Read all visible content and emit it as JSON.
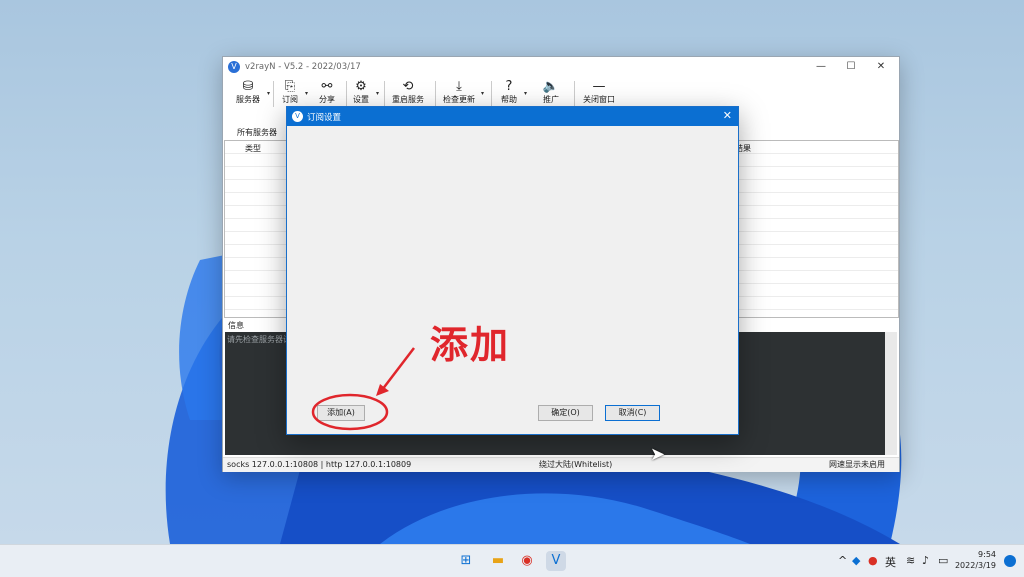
{
  "main_window": {
    "title": "v2rayN - V5.2 - 2022/03/17",
    "controls": {
      "minimize": "—",
      "maximize": "☐",
      "close": "✕"
    },
    "toolbar": [
      {
        "label": "服务器",
        "icon": "database-icon",
        "glyph": "⛁"
      },
      {
        "label": "订阅",
        "icon": "subscribe-icon",
        "glyph": "⎘"
      },
      {
        "label": "分享",
        "icon": "share-icon",
        "glyph": "⚯"
      },
      {
        "label": "设置",
        "icon": "gear-icon",
        "glyph": "⚙"
      },
      {
        "label": "重启服务",
        "icon": "restart-icon",
        "glyph": "⟲"
      },
      {
        "label": "检查更新",
        "icon": "download-icon",
        "glyph": "⤓"
      },
      {
        "label": "帮助",
        "icon": "help-icon",
        "glyph": "?"
      },
      {
        "label": "推广",
        "icon": "speaker-icon",
        "glyph": "🔈"
      },
      {
        "label": "关闭窗口",
        "icon": "minimize-window-icon",
        "glyph": "—"
      }
    ],
    "tab_all_servers": "所有服务器",
    "column_type": "类型",
    "column_result": "结果",
    "info_label": "信息",
    "log_text": "请先检查服务器设",
    "status": {
      "left": "socks 127.0.0.1:10808 | http 127.0.0.1:10809",
      "middle": "绕过大陆(Whitelist)",
      "right": "网速显示未启用"
    }
  },
  "dialog": {
    "title": "订阅设置",
    "close": "✕",
    "add_button": "添加(A)",
    "ok_button": "确定(O)",
    "cancel_button": "取消(C)"
  },
  "annotation": {
    "text": "添加",
    "color": "#e0262c"
  },
  "taskbar": {
    "tray": {
      "chevron": "^",
      "ime": "英"
    },
    "time": "9:54",
    "date": "2022/3/19"
  },
  "colors": {
    "accent": "#0b6fd2",
    "log_bg": "#2d3133"
  }
}
